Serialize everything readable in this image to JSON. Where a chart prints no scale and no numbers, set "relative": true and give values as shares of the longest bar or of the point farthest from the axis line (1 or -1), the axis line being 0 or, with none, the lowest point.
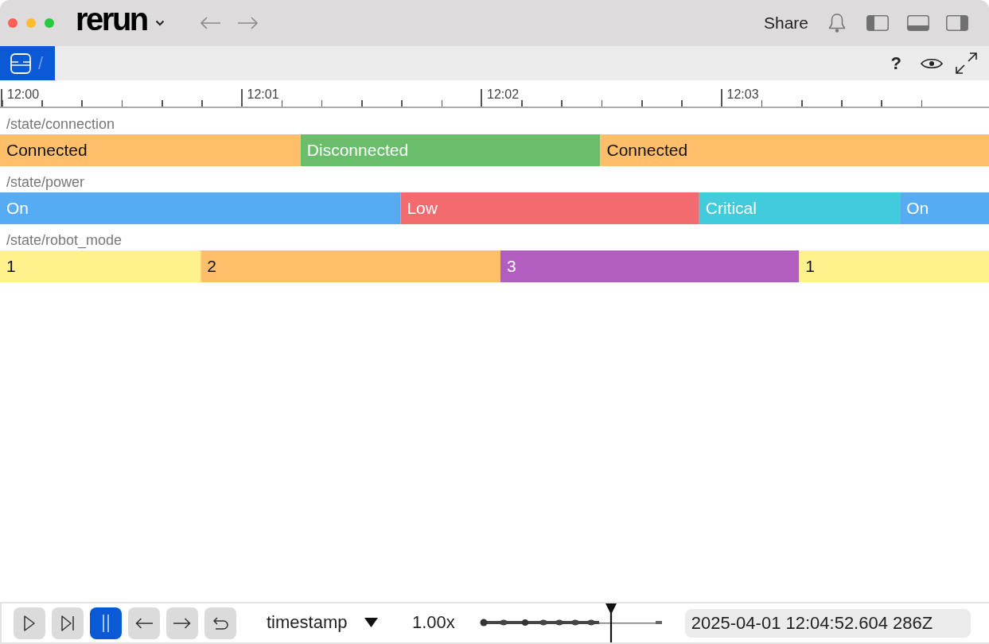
{
  "title_bar": {
    "logo": "rerun",
    "share": "Share"
  },
  "breadcrumb": {
    "separator": "/"
  },
  "view_toolbar": {
    "help": "?"
  },
  "ruler": {
    "labels": [
      "12:00",
      "12:01",
      "12:02",
      "12:03"
    ]
  },
  "timeline": {
    "chart_data": {
      "type": "bar",
      "orientation": "horizontal",
      "stacked": true,
      "relative": true,
      "categories": [
        "/state/connection",
        "/state/power",
        "/state/robot_mode"
      ],
      "series": [
        {
          "name": "Connected",
          "color": "#ffbe6a",
          "values": [
            0.304,
            null,
            null
          ]
        },
        {
          "name": "Disconnected",
          "color": "#69bd6b",
          "values": [
            0.303,
            null,
            null
          ]
        },
        {
          "name": "Connected",
          "color": "#ffbe6a",
          "values": [
            0.393,
            null,
            null
          ]
        },
        {
          "name": "On",
          "color": "#56acf2",
          "values": [
            null,
            0.405,
            null
          ]
        },
        {
          "name": "Low",
          "color": "#f26b6e",
          "values": [
            null,
            0.302,
            null
          ]
        },
        {
          "name": "Critical",
          "color": "#42cbdb",
          "values": [
            null,
            0.203,
            null
          ]
        },
        {
          "name": "On",
          "color": "#56acf2",
          "values": [
            null,
            0.09,
            null
          ]
        },
        {
          "name": "1",
          "color": "#fff18b",
          "values": [
            null,
            null,
            0.203
          ]
        },
        {
          "name": "2",
          "color": "#ffbe6a",
          "values": [
            null,
            null,
            0.303
          ]
        },
        {
          "name": "3",
          "color": "#b25dc0",
          "values": [
            null,
            null,
            0.302
          ]
        },
        {
          "name": "1",
          "color": "#fff18b",
          "values": [
            null,
            null,
            0.192
          ]
        }
      ]
    }
  },
  "playback": {
    "buttons": [
      {
        "kind": "play",
        "selected": false
      },
      {
        "kind": "step",
        "selected": false
      },
      {
        "kind": "pause",
        "selected": true
      },
      {
        "kind": "back",
        "selected": false
      },
      {
        "kind": "forward",
        "selected": false
      },
      {
        "kind": "loop",
        "selected": false
      }
    ],
    "timeline": "timestamp",
    "speed": "1.00x",
    "scrubber": {
      "level": 0.72
    },
    "time": "2025-04-01 12:04:52.604 286Z"
  }
}
